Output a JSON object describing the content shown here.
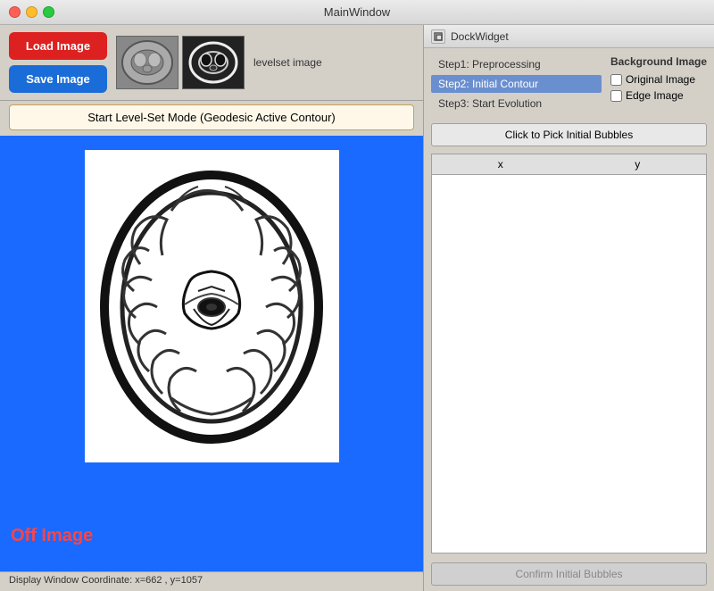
{
  "titlebar": {
    "title": "MainWindow"
  },
  "toolbar": {
    "load_label": "Load Image",
    "save_label": "Save Image",
    "levelset_label": "Start Level-Set Mode (Geodesic Active Contour)",
    "thumbnail_label": "levelset image"
  },
  "image_area": {
    "off_label": "Off Image"
  },
  "status_bar": {
    "text": "Display Window Coordinate: x=662 , y=1057"
  },
  "dock": {
    "title": "DockWidget",
    "steps": [
      {
        "id": "step1",
        "label": "Step1: Preprocessing",
        "active": false
      },
      {
        "id": "step2",
        "label": "Step2: Initial Contour",
        "active": true
      },
      {
        "id": "step3",
        "label": "Step3: Start Evolution",
        "active": false
      }
    ],
    "bg_options": {
      "title": "Background Image",
      "options": [
        {
          "id": "original",
          "label": "Original Image",
          "checked": false
        },
        {
          "id": "edge",
          "label": "Edge Image",
          "checked": false
        }
      ]
    },
    "pick_bubbles_label": "Click to Pick Initial Bubbles",
    "table": {
      "col_x": "x",
      "col_y": "y",
      "rows": []
    },
    "confirm_label": "Confirm Initial Bubbles"
  }
}
